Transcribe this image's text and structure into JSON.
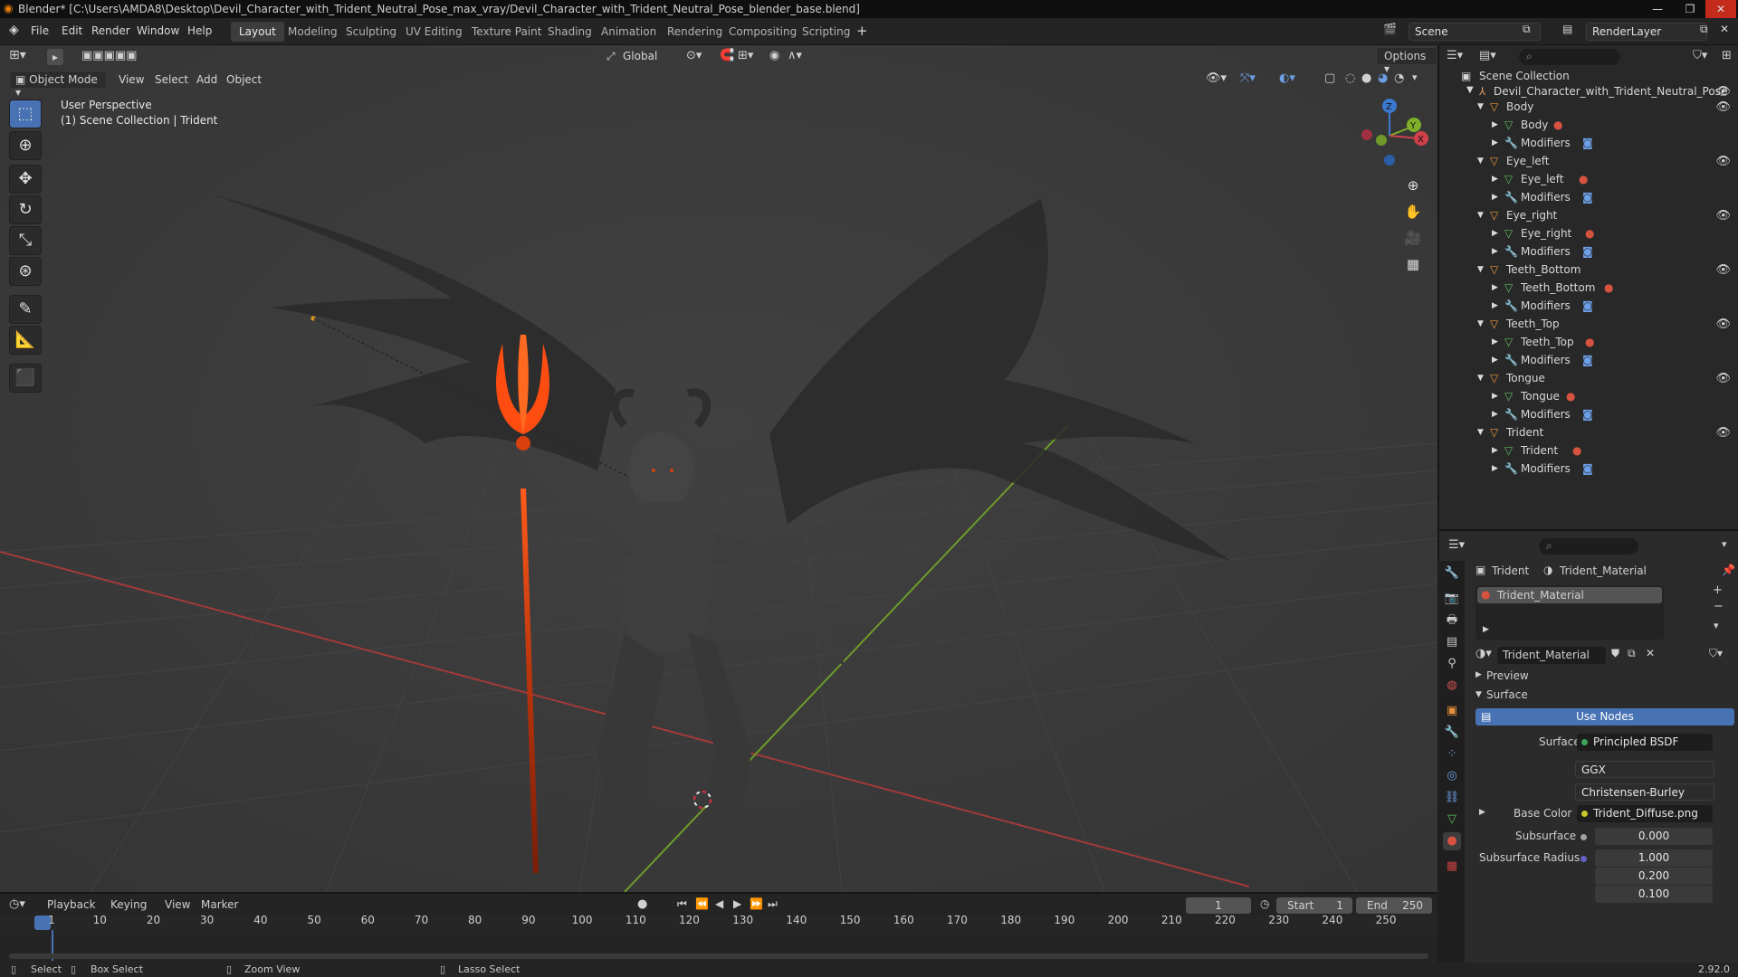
{
  "window": {
    "title": "Blender* [C:\\Users\\AMDA8\\Desktop\\Devil_Character_with_Trident_Neutral_Pose_max_vray/Devil_Character_with_Trident_Neutral_Pose_blender_base.blend]"
  },
  "menu": [
    "File",
    "Edit",
    "Render",
    "Window",
    "Help"
  ],
  "workspaces": [
    "Layout",
    "Modeling",
    "Sculpting",
    "UV Editing",
    "Texture Paint",
    "Shading",
    "Animation",
    "Rendering",
    "Compositing",
    "Scripting"
  ],
  "scene": {
    "scene_name": "Scene",
    "view_layer": "RenderLayer"
  },
  "viewport": {
    "transform_orientation": "Global",
    "options_label": "Options",
    "mode": "Object Mode",
    "header_menu": [
      "View",
      "Select",
      "Add",
      "Object"
    ],
    "overlay_title": "User Perspective",
    "overlay_subtitle": "(1) Scene Collection | Trident",
    "gizmo": {
      "z": "Z",
      "y": "Y",
      "x": "X"
    }
  },
  "outliner": {
    "root": "Scene Collection",
    "collection": "Devil_Character_with_Trident_Neutral_Pose",
    "objects": [
      {
        "name": "Body",
        "mesh": "Body",
        "modifiers": "Modifiers"
      },
      {
        "name": "Eye_left",
        "mesh": "Eye_left",
        "modifiers": "Modifiers"
      },
      {
        "name": "Eye_right",
        "mesh": "Eye_right",
        "modifiers": "Modifiers"
      },
      {
        "name": "Teeth_Bottom",
        "mesh": "Teeth_Bottom",
        "modifiers": "Modifiers"
      },
      {
        "name": "Teeth_Top",
        "mesh": "Teeth_Top",
        "modifiers": "Modifiers"
      },
      {
        "name": "Tongue",
        "mesh": "Tongue",
        "modifiers": "Modifiers"
      },
      {
        "name": "Trident",
        "mesh": "Trident",
        "modifiers": "Modifiers"
      }
    ]
  },
  "properties": {
    "breadcrumb_object": "Trident",
    "breadcrumb_material": "Trident_Material",
    "slot_name": "Trident_Material",
    "material_name": "Trident_Material",
    "preview_label": "Preview",
    "surface_label": "Surface",
    "use_nodes_label": "Use Nodes",
    "surface_field_label": "Surface",
    "surface_value": "Principled BSDF",
    "distribution": "GGX",
    "subsurface_method": "Christensen-Burley",
    "base_color_label": "Base Color",
    "base_color_value": "Trident_Diffuse.png",
    "subsurface_label": "Subsurface",
    "subsurface_value": "0.000",
    "subsurface_radius_label": "Subsurface Radius",
    "subsurface_radius": [
      "1.000",
      "0.200",
      "0.100"
    ]
  },
  "timeline": {
    "menu": [
      "Playback",
      "Keying",
      "View",
      "Marker"
    ],
    "current_frame": "1",
    "start_label": "Start",
    "start": "1",
    "end_label": "End",
    "end": "250",
    "ticks": [
      "1",
      "10",
      "20",
      "30",
      "40",
      "50",
      "60",
      "70",
      "80",
      "90",
      "100",
      "110",
      "120",
      "130",
      "140",
      "150",
      "160",
      "170",
      "180",
      "190",
      "200",
      "210",
      "220",
      "230",
      "240",
      "250"
    ]
  },
  "statusbar": {
    "select": "Select",
    "box_select": "Box Select",
    "zoom_view": "Zoom View",
    "lasso_select": "Lasso Select",
    "version": "2.92.0"
  }
}
